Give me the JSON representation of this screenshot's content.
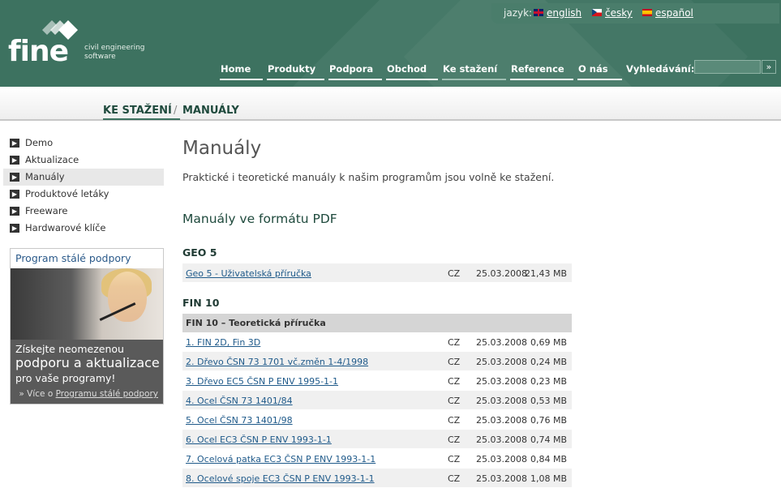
{
  "header": {
    "logo": {
      "word": "fine",
      "tagline": "civil engineering software"
    },
    "language": {
      "label": "jazyk:",
      "options": [
        {
          "label": "english",
          "flag": "uk-flag"
        },
        {
          "label": "česky",
          "flag": "cz-flag"
        },
        {
          "label": "español",
          "flag": "es-flag"
        }
      ]
    },
    "nav": [
      "Home",
      "Produkty",
      "Podpora",
      "Obchod",
      "Ke stažení",
      "Reference",
      "O nás"
    ],
    "search": {
      "label": "Vyhledávání:",
      "value": "",
      "button": "»"
    }
  },
  "breadcrumb": {
    "section": "KE STAŽENÍ",
    "separator": "/",
    "current": "MANUÁLY"
  },
  "sidebar": {
    "items": [
      "Demo",
      "Aktualizace",
      "Manuály",
      "Produktové letáky",
      "Freeware",
      "Hardwarové klíče"
    ],
    "active_index": 2,
    "promo": {
      "title": "Program stálé podpory",
      "line1": "Získejte neomezenou",
      "line2": "podporu a aktualizace",
      "line3": "pro vaše programy!",
      "more_prefix": "» Více o",
      "more_link": "Programu stálé podpory"
    }
  },
  "main": {
    "title": "Manuály",
    "intro": "Praktické i teoretické manuály k našim programům jsou volně ke stažení.",
    "subtitle": "Manuály ve formátu PDF",
    "sections": [
      {
        "heading": "GEO 5",
        "rows": [
          {
            "name": "Geo 5 - Uživatelská příručka",
            "lang": "CZ",
            "date": "25.03.2008",
            "size": "21,43 MB"
          }
        ]
      },
      {
        "heading": "FIN 10",
        "group": "FIN 10 – Teoretická příručka",
        "rows": [
          {
            "name": "1. FIN 2D, Fin 3D",
            "lang": "CZ",
            "date": "25.03.2008",
            "size": "0,69 MB"
          },
          {
            "name": "2. Dřevo ČSN 73 1701 vč.změn 1-4/1998",
            "lang": "CZ",
            "date": "25.03.2008",
            "size": "0,24 MB"
          },
          {
            "name": "3. Dřevo EC5 ČSN P ENV 1995-1-1",
            "lang": "CZ",
            "date": "25.03.2008",
            "size": "0,23 MB"
          },
          {
            "name": "4. Ocel ČSN 73 1401/84",
            "lang": "CZ",
            "date": "25.03.2008",
            "size": "0,53 MB"
          },
          {
            "name": "5. Ocel ČSN 73 1401/98",
            "lang": "CZ",
            "date": "25.03.2008",
            "size": "0,76 MB"
          },
          {
            "name": "6. Ocel EC3 ČSN P ENV 1993-1-1",
            "lang": "CZ",
            "date": "25.03.2008",
            "size": "0,74 MB"
          },
          {
            "name": "7. Ocelová patka EC3 ČSN P ENV 1993-1-1",
            "lang": "CZ",
            "date": "25.03.2008",
            "size": "0,84 MB"
          },
          {
            "name": "8. Ocelové spoje EC3 ČSN P ENV 1993-1-1",
            "lang": "CZ",
            "date": "25.03.2008",
            "size": "1,08 MB"
          }
        ]
      }
    ]
  },
  "colors": {
    "header_bg": "#3d7260",
    "link": "#1f5a8a",
    "heading": "#1f4a3d"
  }
}
